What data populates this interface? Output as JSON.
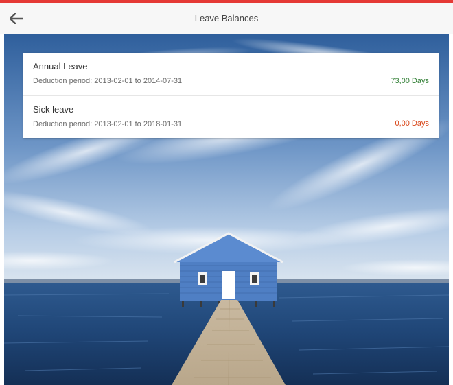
{
  "header": {
    "title": "Leave Balances",
    "back_icon": "arrow-left-icon"
  },
  "balances": [
    {
      "name": "Annual Leave",
      "period_prefix": "Deduction period:",
      "period": "2013-02-01 to 2014-07-31",
      "days": "73,00 Days",
      "days_color": "#2e7d32"
    },
    {
      "name": "Sick leave",
      "period_prefix": "Deduction period:",
      "period": "2013-02-01 to 2018-01-31",
      "days": "0,00 Days",
      "days_color": "#d84315"
    }
  ],
  "colors": {
    "accent": "#e53935",
    "header_bg": "#f7f7f7"
  }
}
